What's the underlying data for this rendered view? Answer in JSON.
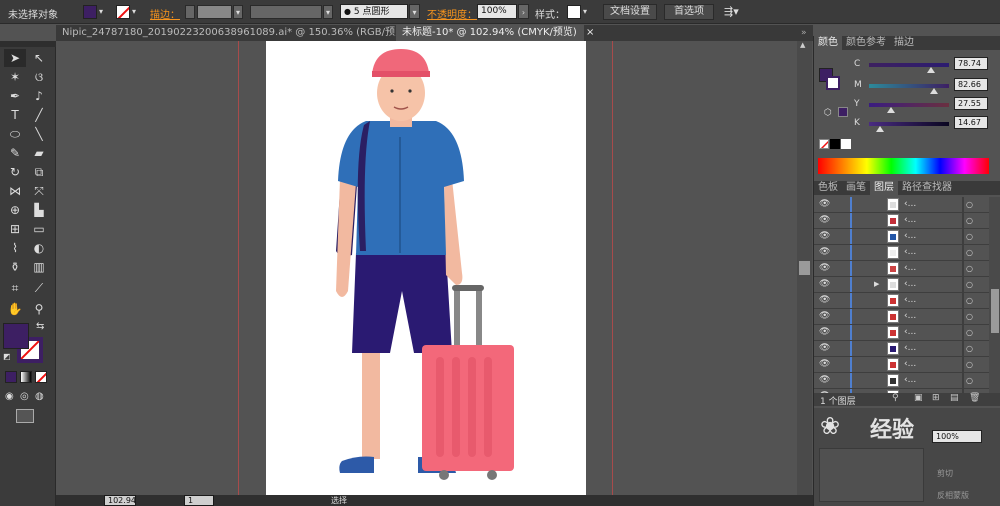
{
  "control_bar": {
    "selection_label": "未选择对象",
    "stroke_label": "描边：",
    "brush_value": "5 点圆形",
    "opacity_label": "不透明度：",
    "opacity_value": "100%",
    "style_label": "样式：",
    "doc_settings_button": "文档设置",
    "preferences_button": "首选项",
    "fill_color": "#3d1f63"
  },
  "document_tabs": [
    {
      "label": "Nipic_24787180_20190223200638961089.ai* @ 150.36% (RGB/预览)",
      "active": false
    },
    {
      "label": "未标题-10* @ 102.94% (CMYK/预览)",
      "active": true
    }
  ],
  "status_bar": {
    "zoom": "102.94",
    "page": "1",
    "tool_label": "选择"
  },
  "color_panel": {
    "tabs": [
      "颜色",
      "颜色参考",
      "描边"
    ],
    "channels": [
      {
        "name": "C",
        "value": "78.74"
      },
      {
        "name": "M",
        "value": "82.66"
      },
      {
        "name": "Y",
        "value": "27.55"
      },
      {
        "name": "K",
        "value": "14.67"
      }
    ],
    "fill_color": "#3d1f63"
  },
  "layers_panel": {
    "tabs": [
      "色板",
      "画笔",
      "图层",
      "路径查找器"
    ],
    "rows": [
      "‹...",
      "‹...",
      "‹...",
      "‹...",
      "‹...",
      "‹...",
      "‹...",
      "‹...",
      "‹...",
      "‹...",
      "‹...",
      "‹...",
      "‹..."
    ],
    "footer_label": "1 个图层"
  },
  "lower_panel": {
    "opacity_value": "100%",
    "check1": "剪切",
    "check2": "反相蒙版"
  },
  "watermark": {
    "text": "经验"
  }
}
